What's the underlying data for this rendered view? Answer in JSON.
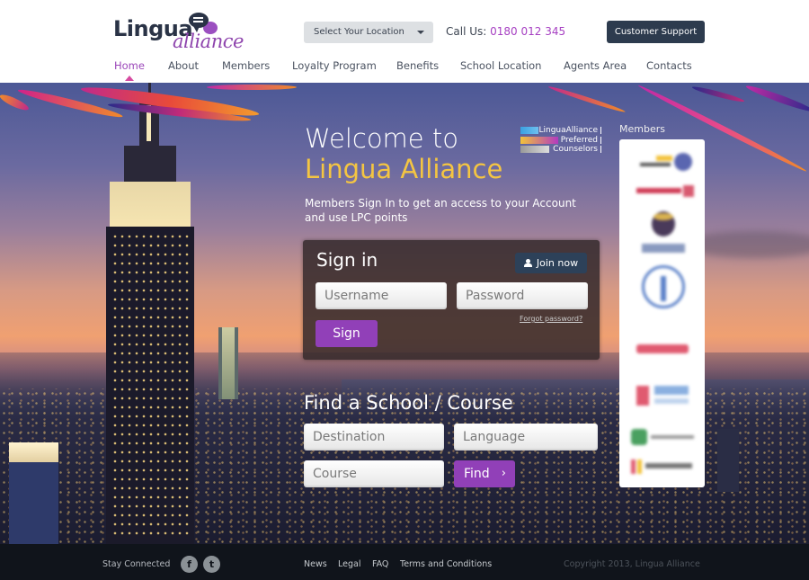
{
  "header": {
    "logo": {
      "primary": "Lingua",
      "secondary": "alliance"
    },
    "location_select": {
      "selected": "Select Your Location"
    },
    "call": {
      "label": "Call Us:",
      "number": "0180 012 345"
    },
    "support_button": "Customer Support"
  },
  "nav": {
    "items": [
      {
        "label": "Home",
        "active": true
      },
      {
        "label": "About"
      },
      {
        "label": "Members"
      },
      {
        "label": "Loyalty Program"
      },
      {
        "label": "Benefits"
      },
      {
        "label": "School Location"
      },
      {
        "label": "Agents Area"
      },
      {
        "label": "Contacts"
      }
    ]
  },
  "hero": {
    "welcome_line1": "Welcome to",
    "welcome_line2": "Lingua Alliance",
    "intro": "Members Sign In to get an access to your Account and use LPC points",
    "lpc_badge": [
      "LinguaAlliance",
      "Preferred",
      "Counselors"
    ]
  },
  "signin": {
    "title": "Sign in",
    "join_button": "Join now",
    "username_placeholder": "Username",
    "password_placeholder": "Password",
    "forgot_link": "Forgot password?",
    "submit": "Sign"
  },
  "find": {
    "title": "Find a School / Course",
    "destination": "Destination",
    "language": "Language",
    "course": "Course",
    "button": "Find",
    "button_icon": "chevron-right-icon"
  },
  "members": {
    "label": "Members",
    "logo_count": 8
  },
  "footer": {
    "stay_connected": "Stay Connected",
    "social": [
      {
        "name": "facebook-icon",
        "glyph": "f"
      },
      {
        "name": "twitter-icon",
        "glyph": "t"
      }
    ],
    "links": [
      "News",
      "Legal",
      "FAQ",
      "Terms and Conditions"
    ],
    "copyright": "Copyright 2013, Lingua Alliance"
  },
  "colors": {
    "accent_purple": "#9140b8",
    "highlight_yellow": "#f4c542",
    "navy": "#2d3b4e",
    "footer_bg": "#10141b"
  }
}
